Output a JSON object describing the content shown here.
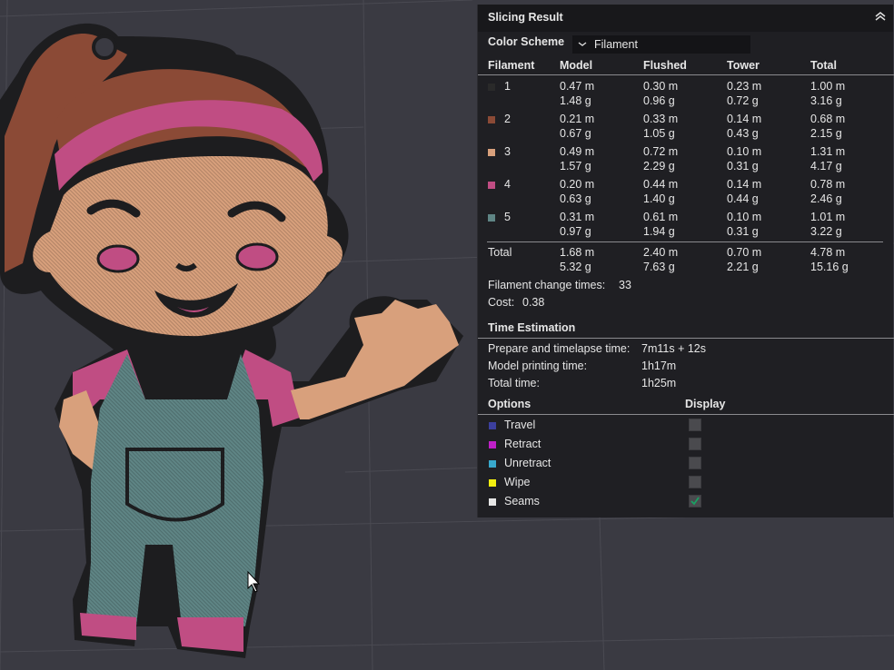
{
  "panel": {
    "title": "Slicing Result",
    "color_scheme_label": "Color Scheme",
    "color_scheme_value": "Filament",
    "columns": [
      "Filament",
      "Model",
      "Flushed",
      "Tower",
      "Total"
    ],
    "filaments": [
      {
        "id": "1",
        "color": "#2a2a2a",
        "model": [
          "0.47 m",
          "1.48 g"
        ],
        "flushed": [
          "0.30 m",
          "0.96 g"
        ],
        "tower": [
          "0.23 m",
          "0.72 g"
        ],
        "total": [
          "1.00 m",
          "3.16 g"
        ]
      },
      {
        "id": "2",
        "color": "#8b4a36",
        "model": [
          "0.21 m",
          "0.67 g"
        ],
        "flushed": [
          "0.33 m",
          "1.05 g"
        ],
        "tower": [
          "0.14 m",
          "0.43 g"
        ],
        "total": [
          "0.68 m",
          "2.15 g"
        ]
      },
      {
        "id": "3",
        "color": "#d8a07c",
        "model": [
          "0.49 m",
          "1.57 g"
        ],
        "flushed": [
          "0.72 m",
          "2.29 g"
        ],
        "tower": [
          "0.10 m",
          "0.31 g"
        ],
        "total": [
          "1.31 m",
          "4.17 g"
        ]
      },
      {
        "id": "4",
        "color": "#c04d83",
        "model": [
          "0.20 m",
          "0.63 g"
        ],
        "flushed": [
          "0.44 m",
          "1.40 g"
        ],
        "tower": [
          "0.14 m",
          "0.44 g"
        ],
        "total": [
          "0.78 m",
          "2.46 g"
        ]
      },
      {
        "id": "5",
        "color": "#5f8585",
        "model": [
          "0.31 m",
          "0.97 g"
        ],
        "flushed": [
          "0.61 m",
          "1.94 g"
        ],
        "tower": [
          "0.10 m",
          "0.31 g"
        ],
        "total": [
          "1.01 m",
          "3.22 g"
        ]
      }
    ],
    "total_row": {
      "label": "Total",
      "model": [
        "1.68 m",
        "5.32 g"
      ],
      "flushed": [
        "2.40 m",
        "7.63 g"
      ],
      "tower": [
        "0.70 m",
        "2.21 g"
      ],
      "total": [
        "4.78 m",
        "15.16 g"
      ]
    },
    "filament_change_label": "Filament change times:",
    "filament_change_value": "33",
    "cost_label": "Cost:",
    "cost_value": "0.38",
    "time_section": "Time Estimation",
    "times": [
      {
        "label": "Prepare and timelapse time:",
        "value": "7m11s + 12s"
      },
      {
        "label": "Model printing time:",
        "value": "1h17m"
      },
      {
        "label": "Total time:",
        "value": "1h25m"
      }
    ],
    "options_label": "Options",
    "display_label": "Display",
    "options": [
      {
        "name": "Travel",
        "color": "#3c3f9e",
        "checked": false
      },
      {
        "name": "Retract",
        "color": "#c020c8",
        "checked": false
      },
      {
        "name": "Unretract",
        "color": "#38a8cc",
        "checked": false
      },
      {
        "name": "Wipe",
        "color": "#f2ee10",
        "checked": false
      },
      {
        "name": "Seams",
        "color": "#e6e6e6",
        "checked": true
      }
    ]
  }
}
